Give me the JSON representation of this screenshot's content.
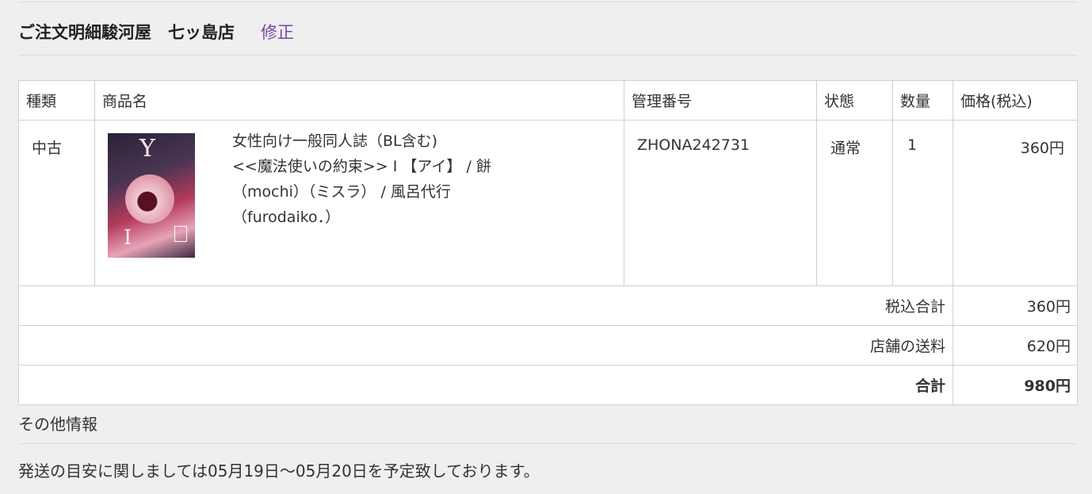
{
  "header": {
    "title": "ご注文明細駿河屋　七ッ島店",
    "edit_link": "修正"
  },
  "table": {
    "columns": [
      "種類",
      "商品名",
      "管理番号",
      "状態",
      "数量",
      "価格(税込)"
    ],
    "item": {
      "kind": "中古",
      "cover_icon": "book-cover-image",
      "product_lines": [
        "女性向け一般同人誌（BL含む)",
        "<<魔法使いの約束>> I 【アイ】 / 餅",
        "（mochi）（ミスラ） / 風呂代行",
        "（furodaiko．）"
      ],
      "code": "ZHONA242731",
      "state": "通常",
      "quantity": "1",
      "price": "360円"
    },
    "summary": [
      {
        "label": "税込合計",
        "value": "360円",
        "bold": false
      },
      {
        "label": "店舗の送料",
        "value": "620円",
        "bold": false
      },
      {
        "label": "合計",
        "value": "980円",
        "bold": true
      }
    ]
  },
  "other_info": {
    "title": "その他情報",
    "note": "発送の目安に関しましては05月19日～05月20日を予定致しております。"
  },
  "colors": {
    "background": "#efefef",
    "link": "#7248a6",
    "border": "#cfcfcf"
  }
}
